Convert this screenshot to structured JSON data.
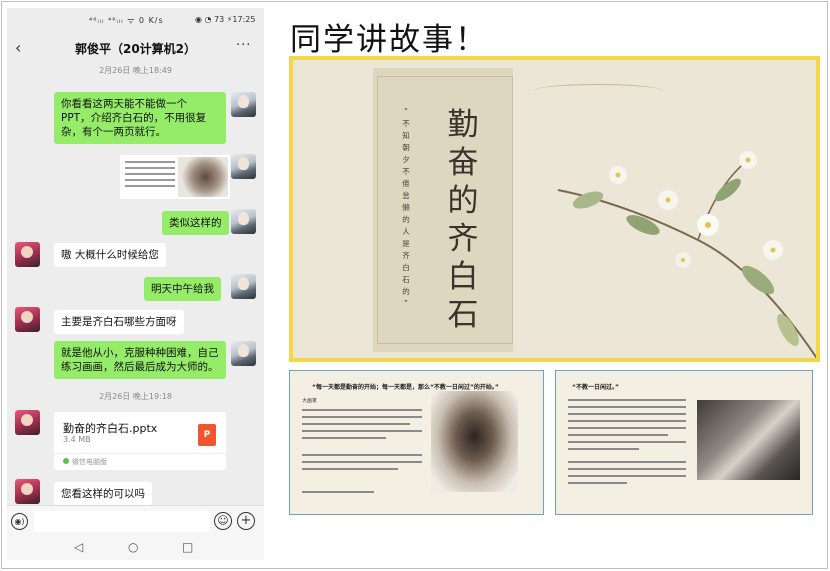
{
  "status_bar": {
    "left_text": "⁴⁶ᵢₗₗ ⁴⁶ᵢₗₗ ᯤ 0 K/s",
    "right_text": "◉ ◔ 73 ⚡17:25"
  },
  "chat": {
    "title": "郭俊平（20计算机2）",
    "back_icon": "‹",
    "more_icon": "···",
    "time_1": "2月26日 晚上18:49",
    "time_2": "2月26日 晚上19:18",
    "messages": [
      {
        "side": "right",
        "text": "你看看这两天能不能做一个 PPT，介绍齐白石的，不用很复杂，有个一两页就行。"
      },
      {
        "side": "right",
        "type": "image"
      },
      {
        "side": "right",
        "text": "类似这样的"
      },
      {
        "side": "left",
        "text": "嗷 大概什么时候给您"
      },
      {
        "side": "right",
        "text": "明天中午给我"
      },
      {
        "side": "left",
        "text": "主要是齐白石哪些方面呀"
      },
      {
        "side": "right",
        "text": "就是他从小，克服种种困难，自己练习画画，然后最后成为大师的。"
      },
      {
        "side": "left",
        "text": "您看这样的可以吗"
      }
    ],
    "file": {
      "name": "勤奋的齐白石.pptx",
      "size": "3.4 MB",
      "source": "微信电脑版",
      "icon_label": "P",
      "icon_color": "#f0562d"
    },
    "voice_icon": "◉)",
    "emoji_icon": "☺",
    "plus_icon": "+",
    "nav_back": "◁",
    "nav_home": "○",
    "nav_recent": "□"
  },
  "headline": "同学讲故事！",
  "main_slide": {
    "title_chars": [
      "勤",
      "奋",
      "的",
      "齐",
      "白",
      "石"
    ],
    "subtitle": "“ 不 知 朝 夕 不 倦 怠 懒 的 人 是 齐 白 石 的 ”",
    "border_color": "#f4d64a"
  },
  "slide_a": {
    "heading": "“每一天都是勤奋的开始；每一天都是，那么“不教一日闲过”的开始。”",
    "label": "大画家"
  },
  "slide_b": {
    "heading": "“不教一日闲过。”"
  }
}
